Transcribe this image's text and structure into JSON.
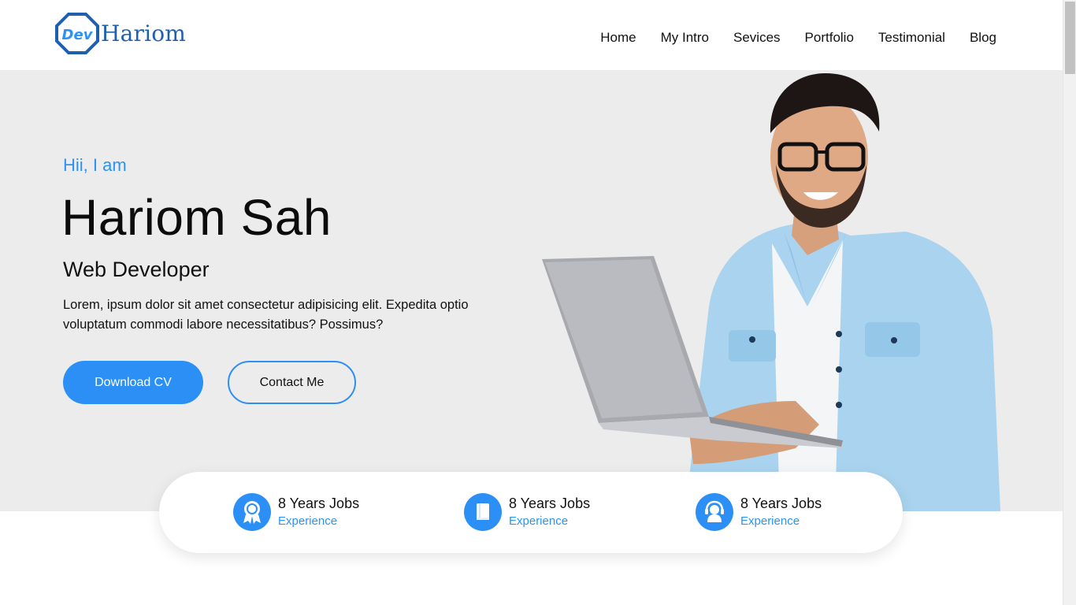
{
  "brand": {
    "logo_badge": "Dev",
    "name": "Hariom",
    "color": "#1f5fb0"
  },
  "nav": {
    "items": [
      "Home",
      "My Intro",
      "Sevices",
      "Portfolio",
      "Testimonial",
      "Blog"
    ]
  },
  "hero": {
    "greeting": "Hii, I am",
    "name": "Hariom Sah",
    "role": "Web Developer",
    "bio": "Lorem, ipsum dolor sit amet consectetur adipisicing elit. Expedita optio voluptatum commodi labore necessitatibus? Possimus?",
    "primary_button": "Download CV",
    "secondary_button": "Contact Me",
    "accent_color": "#2b8ff5",
    "background_color": "#ececec"
  },
  "stats": [
    {
      "title": "8 Years Jobs",
      "subtitle": "Experience",
      "icon": "award-ribbon-icon"
    },
    {
      "title": "8 Years Jobs",
      "subtitle": "Experience",
      "icon": "book-icon"
    },
    {
      "title": "8 Years Jobs",
      "subtitle": "Experience",
      "icon": "headset-support-icon"
    }
  ]
}
